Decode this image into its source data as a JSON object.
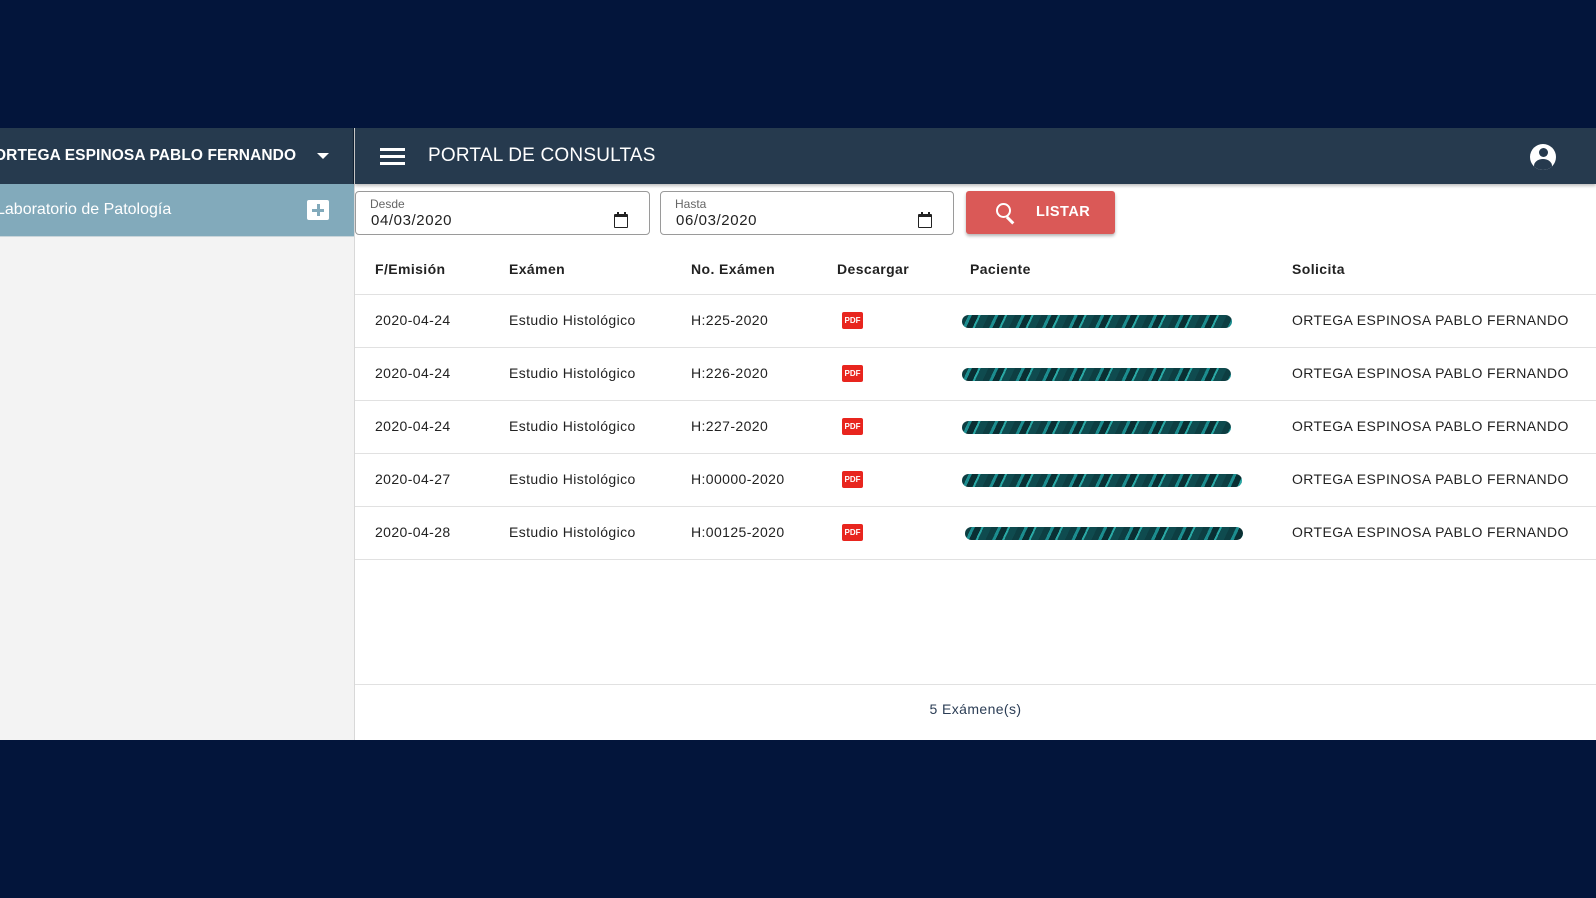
{
  "sidebar": {
    "user_name": "ORTEGA ESPINOSA PABLO FERNANDO",
    "lab_item_label": "Laboratorio de Patología"
  },
  "header": {
    "title": "PORTAL DE CONSULTAS"
  },
  "filters": {
    "desde_label": "Desde",
    "desde_value": "04/03/2020",
    "hasta_label": "Hasta",
    "hasta_value": "06/03/2020",
    "listar_label": "LISTAR"
  },
  "table": {
    "columns": [
      "F/Emisión",
      "Exámen",
      "No. Exámen",
      "Descargar",
      "Paciente",
      "Solicita"
    ],
    "rows": [
      {
        "fecha": "2020-04-24",
        "examen": "Estudio Histológico",
        "numero": "H:225-2020",
        "descargar": "PDF",
        "solicita": "ORTEGA ESPINOSA PABLO FERNANDO"
      },
      {
        "fecha": "2020-04-24",
        "examen": "Estudio Histológico",
        "numero": "H:226-2020",
        "descargar": "PDF",
        "solicita": "ORTEGA ESPINOSA PABLO FERNANDO"
      },
      {
        "fecha": "2020-04-24",
        "examen": "Estudio Histológico",
        "numero": "H:227-2020",
        "descargar": "PDF",
        "solicita": "ORTEGA ESPINOSA PABLO FERNANDO"
      },
      {
        "fecha": "2020-04-27",
        "examen": "Estudio Histológico",
        "numero": "H:00000-2020",
        "descargar": "PDF",
        "solicita": "ORTEGA ESPINOSA PABLO FERNANDO"
      },
      {
        "fecha": "2020-04-28",
        "examen": "Estudio Histológico",
        "numero": "H:00125-2020",
        "descargar": "PDF",
        "solicita": "ORTEGA ESPINOSA PABLO FERNANDO"
      }
    ]
  },
  "footer": {
    "count_label": "5 Exámene(s)"
  },
  "colors": {
    "background": "#03153b",
    "topbar": "#263a4e",
    "sidebar_item": "#82aabb",
    "listar_button": "#da5957",
    "pdf_icon": "#e8251e"
  },
  "icons": {
    "dropdown": "chevron-down-icon",
    "add": "plus-icon",
    "menu": "hamburger-icon",
    "account": "account-circle-icon",
    "calendar": "calendar-icon",
    "search": "search-icon",
    "pdf": "pdf-icon"
  }
}
